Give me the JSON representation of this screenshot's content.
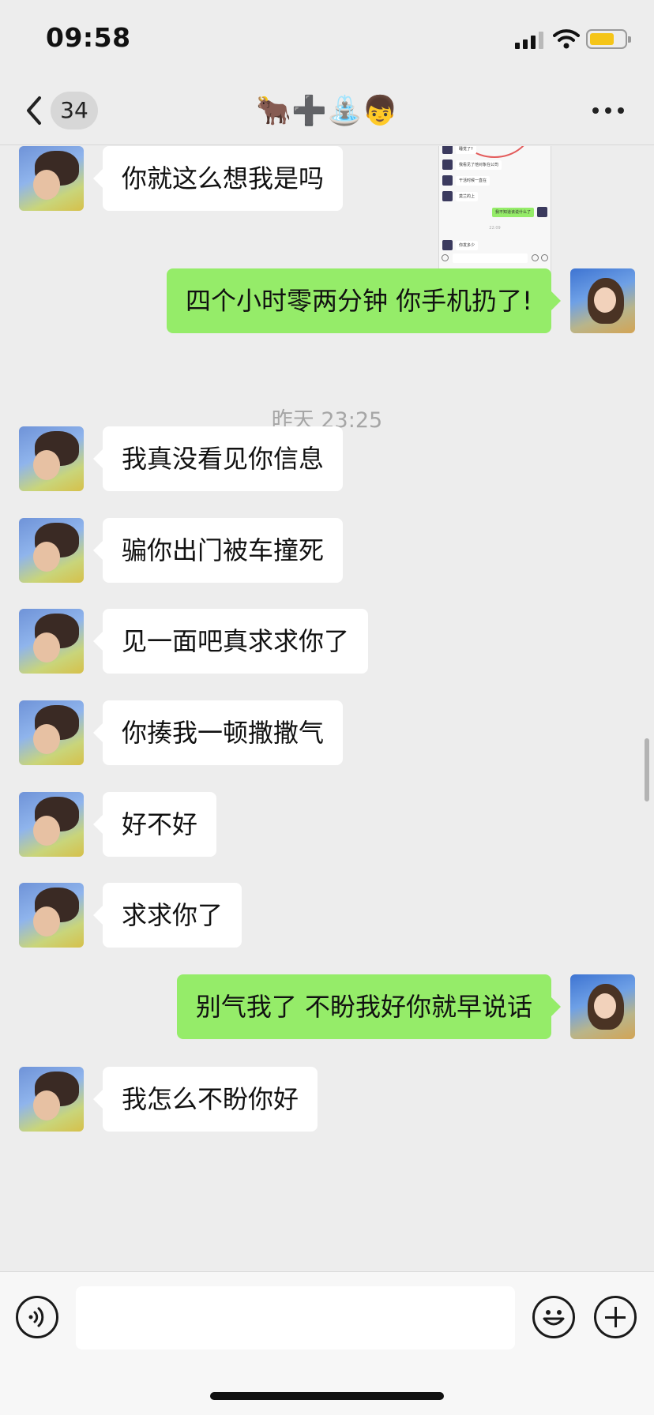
{
  "status_bar": {
    "time": "09:58",
    "battery_color": "#f5c518"
  },
  "nav": {
    "back_icon": "chevron-left-icon",
    "unread_count": "34",
    "title": "🐂➕⛲👦",
    "more_icon": "ellipsis-icon"
  },
  "shared_screenshot": {
    "rows": [
      {
        "side": "other",
        "text": "睡觉了?"
      },
      {
        "side": "other",
        "text": "我看见了他对象在公司"
      },
      {
        "side": "other",
        "text": "干活时候一直在"
      },
      {
        "side": "other",
        "text": "莫兰的上"
      },
      {
        "side": "me",
        "text": "我不知道该说什么了"
      },
      {
        "side": "other",
        "text": "你发多少"
      }
    ],
    "time": "22:09"
  },
  "messages": [
    {
      "side": "me",
      "text": "四个小时零两分钟 你手机扔了!"
    },
    {
      "timestamp": "昨天 23:25"
    },
    {
      "side": "other",
      "text": "我真没看见你信息"
    },
    {
      "side": "other",
      "text": "骗你出门被车撞死"
    },
    {
      "side": "other",
      "text": "见一面吧真求求你了"
    },
    {
      "side": "other",
      "text": "你揍我一顿撒撒气"
    },
    {
      "side": "other",
      "text": "好不好"
    },
    {
      "side": "other",
      "text": "求求你了"
    },
    {
      "side": "me",
      "text": "别气我了 不盼我好你就早说话"
    },
    {
      "side": "other",
      "text": "我怎么不盼你好"
    },
    {
      "side": "other",
      "text": "你就这么想我是吗"
    }
  ],
  "input_bar": {
    "voice_icon": "voice-icon",
    "text_value": "",
    "emoji_icon": "emoji-icon",
    "plus_icon": "plus-icon"
  },
  "colors": {
    "my_bubble": "#95ec69",
    "other_bubble": "#ffffff",
    "background": "#ededed"
  }
}
